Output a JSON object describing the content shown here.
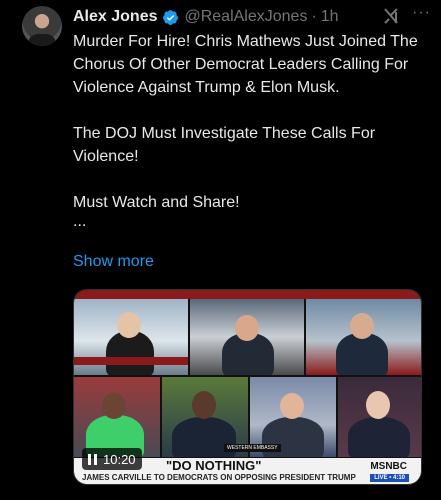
{
  "post": {
    "author_name": "Alex Jones",
    "handle": "@RealAlexJones",
    "separator": "·",
    "time": "1h",
    "text_paragraphs": [
      "Murder For Hire! Chris Mathews Just Joined The Chorus Of Other Democrat Leaders Calling For Violence Against Trump & Elon Musk.",
      "The DOJ Must Investigate These Calls For Violence!",
      "Must Watch and Share!"
    ],
    "ellipsis": "...",
    "show_more": "Show more",
    "more_icon_text": "···"
  },
  "video": {
    "elapsed": "10:20",
    "headline": "\"DO NOTHING\"",
    "ticker": "JAMES CARVILLE TO DEMOCRATS ON OPPOSING PRESIDENT TRUMP",
    "network": "MSNBC",
    "live_badge": "LIVE • 4:10",
    "bug": "WESTERN EMBASSY"
  },
  "colors": {
    "background": "#000000",
    "text": "#e7e9ea",
    "muted": "#71767b",
    "link": "#1d9bf0",
    "verified": "#1d9bf0"
  },
  "icons": {
    "verified": "verified-badge-icon",
    "grok": "grok-icon",
    "more": "more-options-icon",
    "pause": "pause-icon"
  }
}
